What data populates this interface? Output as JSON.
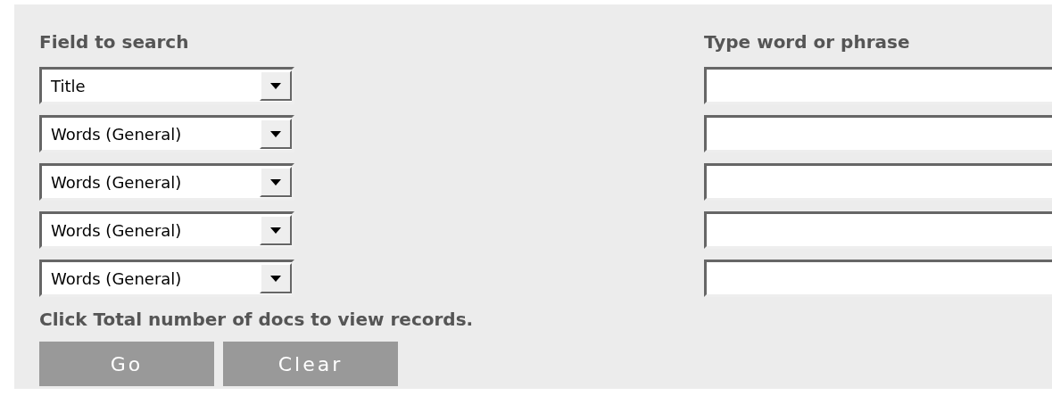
{
  "headings": {
    "field": "Field to search",
    "phrase": "Type word or phrase"
  },
  "rows": [
    {
      "field": "Title"
    },
    {
      "field": "Words (General)"
    },
    {
      "field": "Words (General)"
    },
    {
      "field": "Words (General)"
    },
    {
      "field": "Words (General)"
    }
  ],
  "note": "Click Total number of docs to view records.",
  "buttons": [
    "Go",
    "Clear"
  ]
}
